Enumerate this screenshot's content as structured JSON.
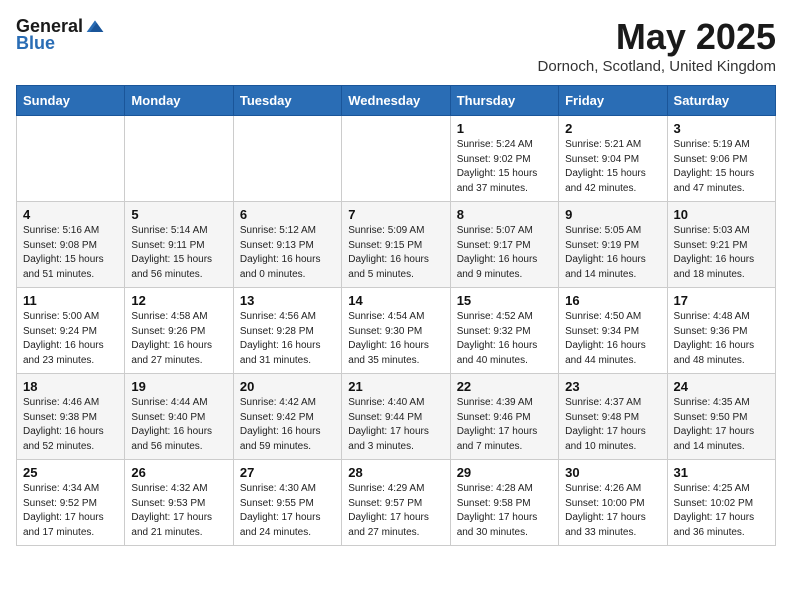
{
  "header": {
    "logo_general": "General",
    "logo_blue": "Blue",
    "title": "May 2025",
    "location": "Dornoch, Scotland, United Kingdom"
  },
  "days_of_week": [
    "Sunday",
    "Monday",
    "Tuesday",
    "Wednesday",
    "Thursday",
    "Friday",
    "Saturday"
  ],
  "weeks": [
    [
      {
        "day": "",
        "info": ""
      },
      {
        "day": "",
        "info": ""
      },
      {
        "day": "",
        "info": ""
      },
      {
        "day": "",
        "info": ""
      },
      {
        "day": "1",
        "info": "Sunrise: 5:24 AM\nSunset: 9:02 PM\nDaylight: 15 hours\nand 37 minutes."
      },
      {
        "day": "2",
        "info": "Sunrise: 5:21 AM\nSunset: 9:04 PM\nDaylight: 15 hours\nand 42 minutes."
      },
      {
        "day": "3",
        "info": "Sunrise: 5:19 AM\nSunset: 9:06 PM\nDaylight: 15 hours\nand 47 minutes."
      }
    ],
    [
      {
        "day": "4",
        "info": "Sunrise: 5:16 AM\nSunset: 9:08 PM\nDaylight: 15 hours\nand 51 minutes."
      },
      {
        "day": "5",
        "info": "Sunrise: 5:14 AM\nSunset: 9:11 PM\nDaylight: 15 hours\nand 56 minutes."
      },
      {
        "day": "6",
        "info": "Sunrise: 5:12 AM\nSunset: 9:13 PM\nDaylight: 16 hours\nand 0 minutes."
      },
      {
        "day": "7",
        "info": "Sunrise: 5:09 AM\nSunset: 9:15 PM\nDaylight: 16 hours\nand 5 minutes."
      },
      {
        "day": "8",
        "info": "Sunrise: 5:07 AM\nSunset: 9:17 PM\nDaylight: 16 hours\nand 9 minutes."
      },
      {
        "day": "9",
        "info": "Sunrise: 5:05 AM\nSunset: 9:19 PM\nDaylight: 16 hours\nand 14 minutes."
      },
      {
        "day": "10",
        "info": "Sunrise: 5:03 AM\nSunset: 9:21 PM\nDaylight: 16 hours\nand 18 minutes."
      }
    ],
    [
      {
        "day": "11",
        "info": "Sunrise: 5:00 AM\nSunset: 9:24 PM\nDaylight: 16 hours\nand 23 minutes."
      },
      {
        "day": "12",
        "info": "Sunrise: 4:58 AM\nSunset: 9:26 PM\nDaylight: 16 hours\nand 27 minutes."
      },
      {
        "day": "13",
        "info": "Sunrise: 4:56 AM\nSunset: 9:28 PM\nDaylight: 16 hours\nand 31 minutes."
      },
      {
        "day": "14",
        "info": "Sunrise: 4:54 AM\nSunset: 9:30 PM\nDaylight: 16 hours\nand 35 minutes."
      },
      {
        "day": "15",
        "info": "Sunrise: 4:52 AM\nSunset: 9:32 PM\nDaylight: 16 hours\nand 40 minutes."
      },
      {
        "day": "16",
        "info": "Sunrise: 4:50 AM\nSunset: 9:34 PM\nDaylight: 16 hours\nand 44 minutes."
      },
      {
        "day": "17",
        "info": "Sunrise: 4:48 AM\nSunset: 9:36 PM\nDaylight: 16 hours\nand 48 minutes."
      }
    ],
    [
      {
        "day": "18",
        "info": "Sunrise: 4:46 AM\nSunset: 9:38 PM\nDaylight: 16 hours\nand 52 minutes."
      },
      {
        "day": "19",
        "info": "Sunrise: 4:44 AM\nSunset: 9:40 PM\nDaylight: 16 hours\nand 56 minutes."
      },
      {
        "day": "20",
        "info": "Sunrise: 4:42 AM\nSunset: 9:42 PM\nDaylight: 16 hours\nand 59 minutes."
      },
      {
        "day": "21",
        "info": "Sunrise: 4:40 AM\nSunset: 9:44 PM\nDaylight: 17 hours\nand 3 minutes."
      },
      {
        "day": "22",
        "info": "Sunrise: 4:39 AM\nSunset: 9:46 PM\nDaylight: 17 hours\nand 7 minutes."
      },
      {
        "day": "23",
        "info": "Sunrise: 4:37 AM\nSunset: 9:48 PM\nDaylight: 17 hours\nand 10 minutes."
      },
      {
        "day": "24",
        "info": "Sunrise: 4:35 AM\nSunset: 9:50 PM\nDaylight: 17 hours\nand 14 minutes."
      }
    ],
    [
      {
        "day": "25",
        "info": "Sunrise: 4:34 AM\nSunset: 9:52 PM\nDaylight: 17 hours\nand 17 minutes."
      },
      {
        "day": "26",
        "info": "Sunrise: 4:32 AM\nSunset: 9:53 PM\nDaylight: 17 hours\nand 21 minutes."
      },
      {
        "day": "27",
        "info": "Sunrise: 4:30 AM\nSunset: 9:55 PM\nDaylight: 17 hours\nand 24 minutes."
      },
      {
        "day": "28",
        "info": "Sunrise: 4:29 AM\nSunset: 9:57 PM\nDaylight: 17 hours\nand 27 minutes."
      },
      {
        "day": "29",
        "info": "Sunrise: 4:28 AM\nSunset: 9:58 PM\nDaylight: 17 hours\nand 30 minutes."
      },
      {
        "day": "30",
        "info": "Sunrise: 4:26 AM\nSunset: 10:00 PM\nDaylight: 17 hours\nand 33 minutes."
      },
      {
        "day": "31",
        "info": "Sunrise: 4:25 AM\nSunset: 10:02 PM\nDaylight: 17 hours\nand 36 minutes."
      }
    ]
  ]
}
